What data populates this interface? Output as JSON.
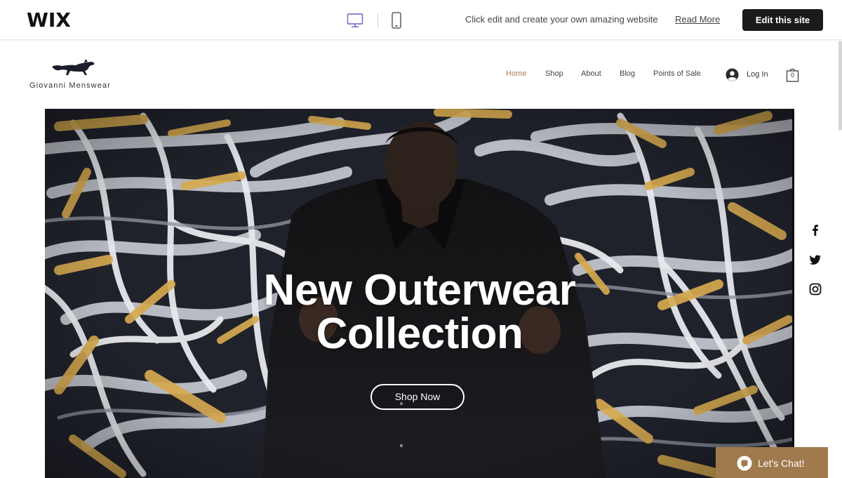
{
  "wix_bar": {
    "logo": "WIX",
    "device_icons": [
      "desktop-icon",
      "mobile-icon"
    ],
    "message": "Click edit and create your own amazing website",
    "read_more": "Read More",
    "edit_button": "Edit this site"
  },
  "site": {
    "brand_name": "Giovanni Menswear",
    "nav": [
      {
        "label": "Home",
        "active": true
      },
      {
        "label": "Shop",
        "active": false
      },
      {
        "label": "About",
        "active": false
      },
      {
        "label": "Blog",
        "active": false
      },
      {
        "label": "Points of Sale",
        "active": false
      }
    ],
    "login_label": "Log In",
    "cart_count": "0"
  },
  "hero": {
    "title_line1": "New Outerwear",
    "title_line2": "Collection",
    "cta": "Shop Now"
  },
  "social": [
    "facebook-icon",
    "twitter-icon",
    "instagram-icon"
  ],
  "chat": {
    "label": "Let's Chat!"
  },
  "colors": {
    "accent": "#b07b4a",
    "chat_bg": "#a07a4c",
    "edit_button_bg": "#1b1b1b"
  }
}
